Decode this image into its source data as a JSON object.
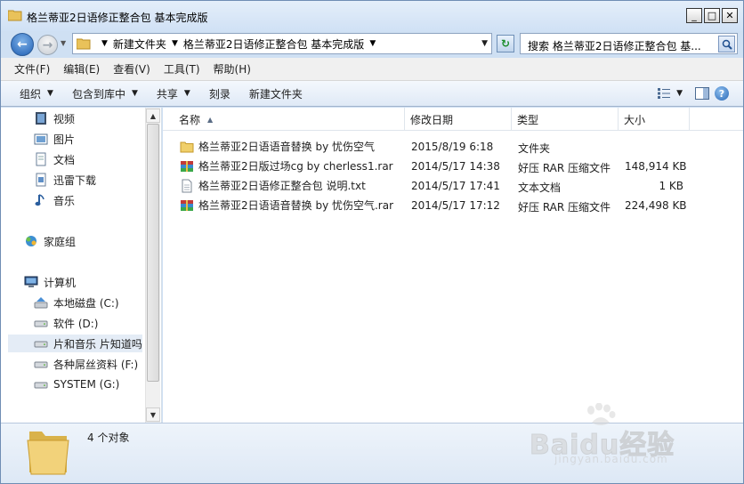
{
  "window": {
    "title": "格兰蒂亚2日语修正整合包 基本完成版",
    "buttons": {
      "minimize": "_",
      "maximize": "□",
      "close": "✕"
    }
  },
  "address": {
    "crumbs": [
      "新建文件夹",
      "格兰蒂亚2日语修正整合包 基本完成版"
    ],
    "search_placeholder": "搜索 格兰蒂亚2日语修正整合包 基..."
  },
  "menu": [
    "文件(F)",
    "编辑(E)",
    "查看(V)",
    "工具(T)",
    "帮助(H)"
  ],
  "commands": {
    "organize": "组织",
    "include": "包含到库中",
    "share": "共享",
    "burn": "刻录",
    "new_folder": "新建文件夹"
  },
  "nav": {
    "libraries": [
      {
        "label": "视频",
        "icon": "video-library-icon"
      },
      {
        "label": "图片",
        "icon": "picture-library-icon"
      },
      {
        "label": "文档",
        "icon": "document-library-icon"
      },
      {
        "label": "迅雷下载",
        "icon": "download-library-icon"
      },
      {
        "label": "音乐",
        "icon": "music-library-icon"
      }
    ],
    "homegroup": "家庭组",
    "computer": "计算机",
    "drives": [
      {
        "label": "本地磁盘 (C:)"
      },
      {
        "label": "软件 (D:)"
      },
      {
        "label": "片和音乐 片知道吗",
        "selected": true
      },
      {
        "label": "各种屌丝资料 (F:)"
      },
      {
        "label": "SYSTEM (G:)"
      }
    ]
  },
  "columns": {
    "name": "名称",
    "date": "修改日期",
    "type": "类型",
    "size": "大小"
  },
  "files": [
    {
      "name": "格兰蒂亚2日语语音替换 by 忧伤空气",
      "date": "2015/8/19 6:18",
      "type": "文件夹",
      "size": "",
      "icon": "folder-icon"
    },
    {
      "name": "格兰蒂亚2日版过场cg by cherless1.rar",
      "date": "2014/5/17 14:38",
      "type": "好压 RAR 压缩文件",
      "size": "148,914 KB",
      "icon": "rar-archive-icon"
    },
    {
      "name": "格兰蒂亚2日语修正整合包 说明.txt",
      "date": "2014/5/17 17:41",
      "type": "文本文档",
      "size": "1 KB",
      "icon": "text-file-icon"
    },
    {
      "name": "格兰蒂亚2日语语音替换 by 忧伤空气.rar",
      "date": "2014/5/17 17:12",
      "type": "好压 RAR 压缩文件",
      "size": "224,498 KB",
      "icon": "rar-archive-icon"
    }
  ],
  "status": {
    "count": "4 个对象"
  },
  "watermark": {
    "brand": "Baidu经验",
    "url": "jingyan.baidu.com"
  }
}
